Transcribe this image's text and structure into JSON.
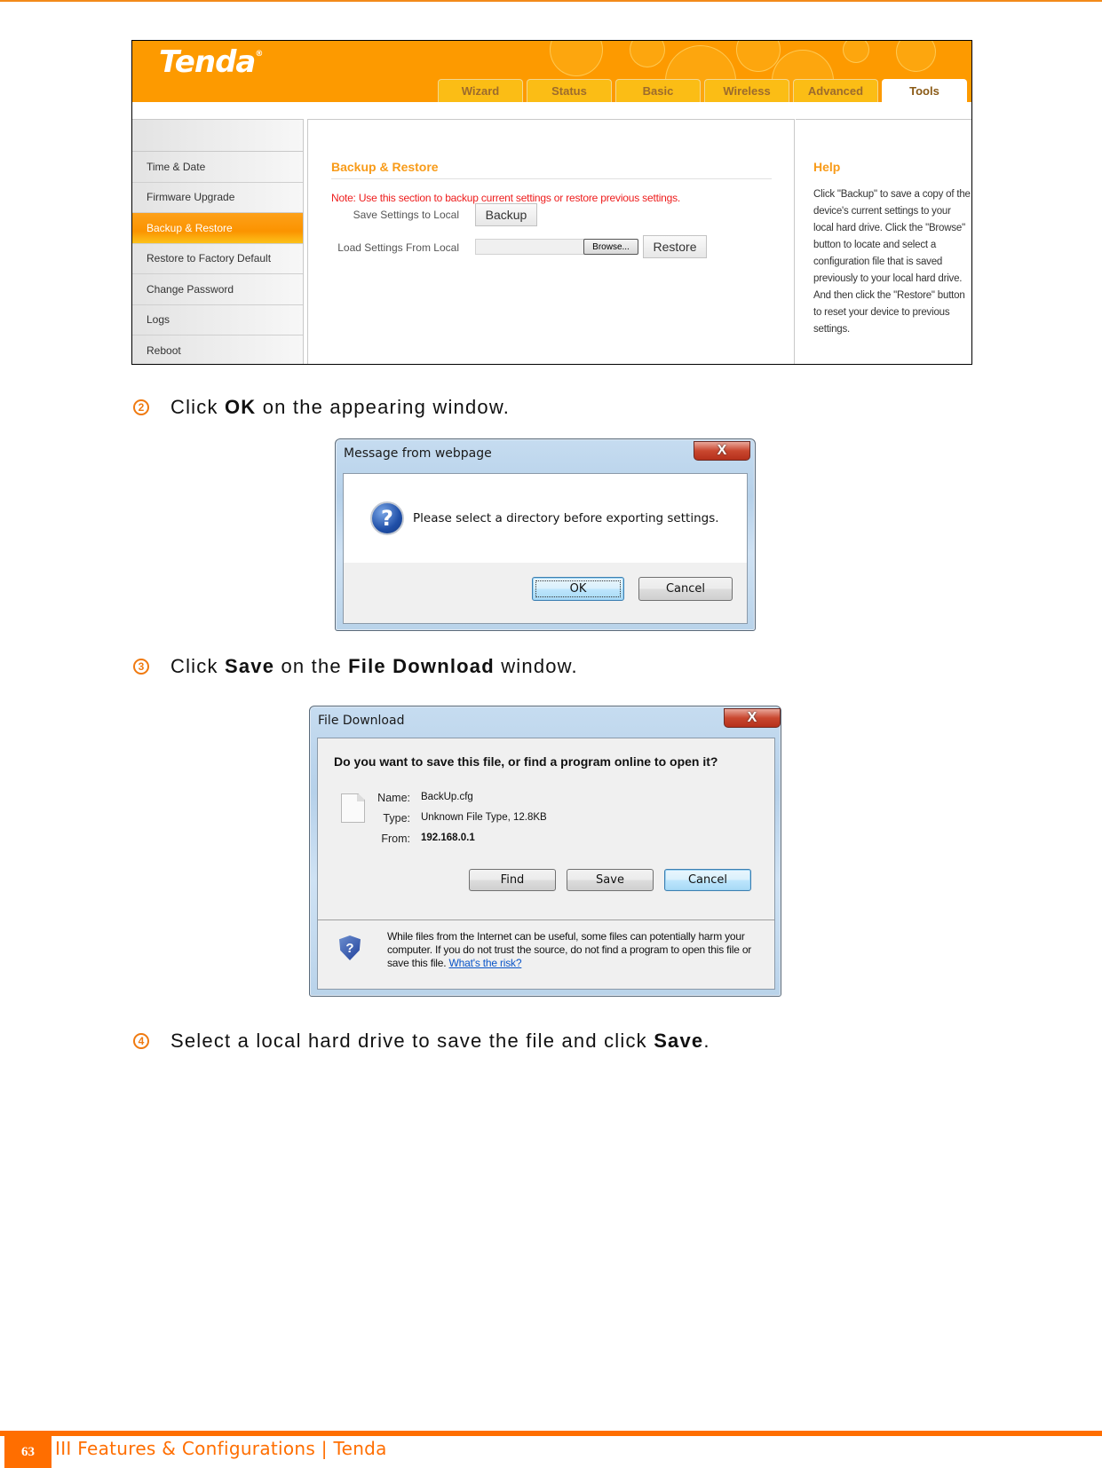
{
  "router_ui": {
    "logo": "Tenda",
    "logo_mark": "®",
    "tabs": [
      {
        "label": "Wizard",
        "active": false
      },
      {
        "label": "Status",
        "active": false
      },
      {
        "label": "Basic",
        "active": false
      },
      {
        "label": "Wireless",
        "active": false
      },
      {
        "label": "Advanced",
        "active": false
      },
      {
        "label": "Tools",
        "active": true
      }
    ],
    "sidebar": [
      {
        "label": "Time & Date",
        "active": false
      },
      {
        "label": "Firmware Upgrade",
        "active": false
      },
      {
        "label": "Backup & Restore",
        "active": true
      },
      {
        "label": "Restore to Factory Default",
        "active": false
      },
      {
        "label": "Change Password",
        "active": false
      },
      {
        "label": "Logs",
        "active": false
      },
      {
        "label": "Reboot",
        "active": false
      }
    ],
    "section_title": "Backup & Restore",
    "note": "Note: Use this section to backup current settings or restore previous settings.",
    "save_label": "Save Settings to Local",
    "backup_button": "Backup",
    "load_label": "Load Settings From Local",
    "file_value": "",
    "browse_button": "Browse...",
    "restore_button": "Restore",
    "help_title": "Help",
    "help_text": "Click \"Backup\" to save a copy of the device's current settings to your local hard drive. Click the \"Browse\" button to locate and select a configuration file that is saved previously to your local hard drive. And then click the \"Restore\" button to reset your device to previous settings."
  },
  "steps": [
    {
      "num": "2",
      "parts": [
        {
          "t": "Click ",
          "b": false
        },
        {
          "t": "OK",
          "b": true
        },
        {
          "t": " on the appearing window.",
          "b": false
        }
      ]
    },
    {
      "num": "3",
      "parts": [
        {
          "t": "Click ",
          "b": false
        },
        {
          "t": "Save",
          "b": true
        },
        {
          "t": " on the ",
          "b": false
        },
        {
          "t": "File Download",
          "b": true
        },
        {
          "t": " window.",
          "b": false
        }
      ]
    },
    {
      "num": "4",
      "parts": [
        {
          "t": "Select a local hard drive to save the file and click ",
          "b": false
        },
        {
          "t": "Save",
          "b": true
        },
        {
          "t": ".",
          "b": false
        }
      ]
    }
  ],
  "message_dialog": {
    "title": "Message from webpage",
    "close_glyph": "X",
    "icon": "question-icon",
    "message": "Please select a directory before exporting settings.",
    "ok_button": "OK",
    "cancel_button": "Cancel"
  },
  "file_download_dialog": {
    "title": "File Download",
    "close_glyph": "X",
    "question": "Do you want to save this file, or find a program online to open it?",
    "name_label": "Name:",
    "name_value": "BackUp.cfg",
    "type_label": "Type:",
    "type_value": "Unknown File Type, 12.8KB",
    "from_label": "From:",
    "from_value": "192.168.0.1",
    "find_button": "Find",
    "save_button": "Save",
    "cancel_button": "Cancel",
    "warning": "While files from the Internet can be useful, some files can potentially harm your computer. If you do not trust the source, do not find a program to open this file or save this file.",
    "risk_link": "What's the risk?"
  },
  "footer": {
    "page_number": "63",
    "title": "III Features & Configurations | Tenda"
  },
  "colors": {
    "accent": "#ff6e00",
    "header_orange": "#fd9a00",
    "note_red": "#ee1c1c",
    "title_orange": "#f89b19"
  }
}
